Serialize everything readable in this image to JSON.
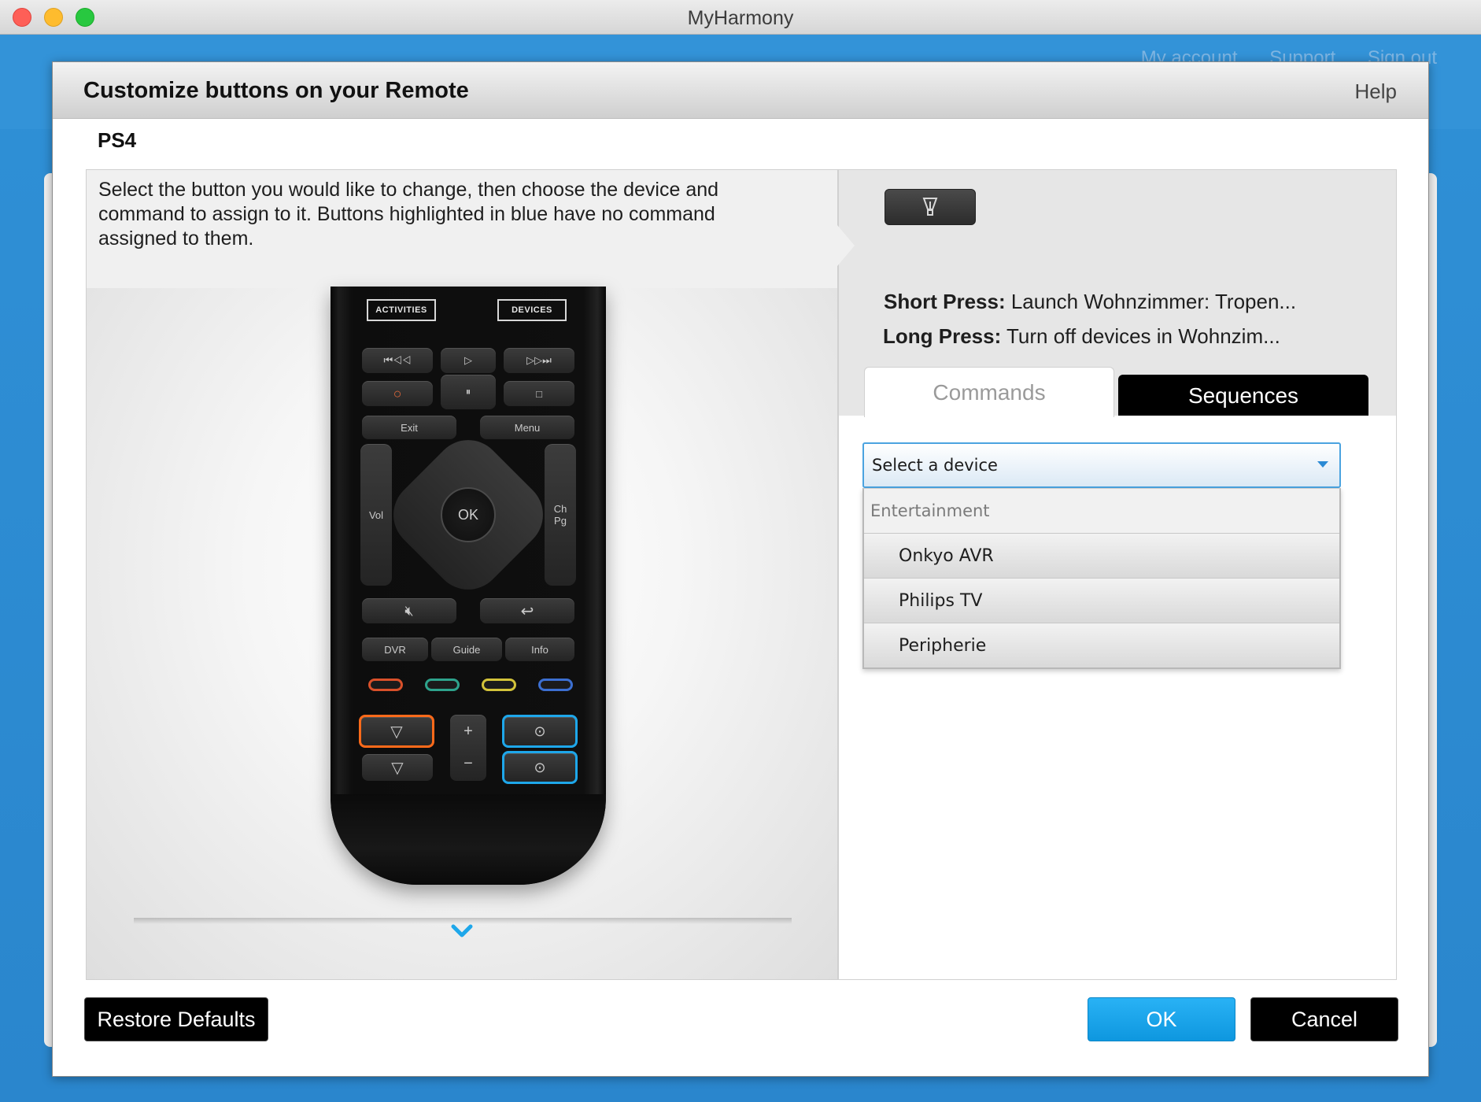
{
  "window": {
    "title": "MyHarmony"
  },
  "top_links": [
    "My account",
    "Support",
    "Sign out"
  ],
  "dialog": {
    "title": "Customize buttons on your Remote",
    "help": "Help",
    "device": "PS4",
    "instructions": "Select the button you would like to change, then choose the device and command to assign to it. Buttons highlighted in blue have no command assigned to them."
  },
  "remote": {
    "activities": "ACTIVITIES",
    "devices": "DEVICES",
    "exit": "Exit",
    "menu": "Menu",
    "vol": "Vol",
    "ch": "Ch",
    "pg": "Pg",
    "ok": "OK",
    "dvr": "DVR",
    "guide": "Guide",
    "info": "Info",
    "plus": "+",
    "minus": "−",
    "color_buttons": [
      "#d9502a",
      "#2ea38c",
      "#d3c33a",
      "#3c6fd1"
    ],
    "highlight_assigned": "#ff6a1a",
    "highlight_unassigned": "#1ea7ea"
  },
  "detail": {
    "selected_icon": "light-bulb-icon",
    "short_press_label": "Short Press:",
    "short_press_value": "Launch Wohnzimmer: Tropen...",
    "long_press_label": "Long Press:",
    "long_press_value": "Turn off devices in Wohnzim..."
  },
  "tabs": {
    "commands": "Commands",
    "sequences": "Sequences",
    "active": "Commands"
  },
  "device_select": {
    "selected": "Select a device",
    "group": "Entertainment",
    "options": [
      "Onkyo AVR",
      "Philips TV",
      "Peripherie"
    ]
  },
  "buttons": {
    "restore": "Restore Defaults",
    "ok": "OK",
    "cancel": "Cancel"
  },
  "colors": {
    "accent": "#1ea7ea",
    "app_bg": "#2b8ad4"
  }
}
